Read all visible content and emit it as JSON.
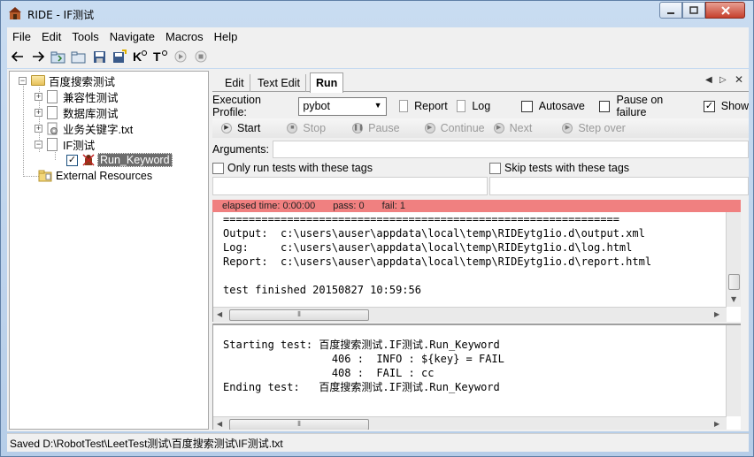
{
  "window": {
    "title": "RIDE - IF测试"
  },
  "menu": [
    "File",
    "Edit",
    "Tools",
    "Navigate",
    "Macros",
    "Help"
  ],
  "toolbar_icons": [
    "back-arrow-icon",
    "forward-arrow-icon",
    "open-suite-icon",
    "open-directory-icon",
    "save-icon",
    "save-all-icon",
    "search-keywords-icon",
    "search-tests-icon",
    "run-icon",
    "stop-icon"
  ],
  "tree": {
    "root": "百度搜索测试",
    "children": [
      "兼容性测试",
      "数据库测试",
      "业务关键字.txt",
      "IF测试"
    ],
    "test": "Run_Keyword",
    "external": "External Resources"
  },
  "tabs": {
    "edit": "Edit",
    "text_edit": "Text Edit",
    "run": "Run"
  },
  "execution": {
    "profile_label": "Execution Profile:",
    "profile_value": "pybot",
    "report": "Report",
    "log": "Log",
    "autosave": "Autosave",
    "pause_on_failure": "Pause on failure",
    "show": "Show"
  },
  "run_controls": {
    "start": "Start",
    "stop": "Stop",
    "pause": "Pause",
    "continue": "Continue",
    "next": "Next",
    "step_over": "Step over"
  },
  "arguments_label": "Arguments:",
  "tags": {
    "only_run": "Only run tests with these tags",
    "skip": "Skip tests with these tags"
  },
  "status": {
    "elapsed": "elapsed time: 0:00:00",
    "pass": "pass: 0",
    "fail": "fail: 1",
    "fail_color": "#f08080"
  },
  "output_console": "==============================================================\nOutput:  c:\\users\\auser\\appdata\\local\\temp\\RIDEytg1io.d\\output.xml\nLog:     c:\\users\\auser\\appdata\\local\\temp\\RIDEytg1io.d\\log.html\nReport:  c:\\users\\auser\\appdata\\local\\temp\\RIDEytg1io.d\\report.html\n\ntest finished 20150827 10:59:56",
  "message_console": "Starting test: 百度搜索测试.IF测试.Run_Keyword\n                 406 :  INFO : ${key} = FAIL\n                 408 :  FAIL : cc\nEnding test:   百度搜索测试.IF测试.Run_Keyword",
  "bottom_status": "Saved D:\\RobotTest\\LeetTest测试\\百度搜索测试\\IF测试.txt"
}
